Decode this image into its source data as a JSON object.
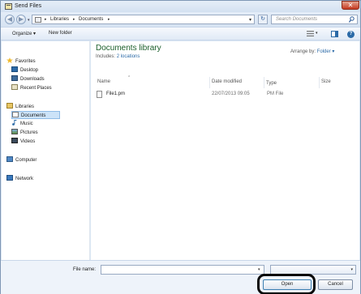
{
  "window": {
    "title": "Send Files",
    "close_glyph": "✕"
  },
  "nav": {
    "back_glyph": "◀",
    "forward_glyph": "▶",
    "breadcrumbs": [
      "Libraries",
      "Documents"
    ],
    "crumb_separator": "▸",
    "search_placeholder": "Search Documents"
  },
  "toolbar": {
    "organize_label": "Organize ▾",
    "new_folder_label": "New folder",
    "help_glyph": "?"
  },
  "sidebar": {
    "items": [
      {
        "label": "Favorites",
        "icon": "star-icon"
      },
      {
        "label": "Desktop",
        "icon": "desktop-icon"
      },
      {
        "label": "Downloads",
        "icon": "downloads-icon"
      },
      {
        "label": "Recent Places",
        "icon": "recent-places-icon"
      },
      {
        "label": "Libraries",
        "icon": "libraries-icon"
      },
      {
        "label": "Documents",
        "icon": "documents-icon",
        "selected": true
      },
      {
        "label": "Music",
        "icon": "music-icon"
      },
      {
        "label": "Pictures",
        "icon": "pictures-icon"
      },
      {
        "label": "Videos",
        "icon": "videos-icon"
      },
      {
        "label": "Computer",
        "icon": "computer-icon"
      },
      {
        "label": "Network",
        "icon": "network-icon"
      }
    ]
  },
  "library": {
    "title": "Documents library",
    "includes_label": "Includes:",
    "includes_link": "2 locations",
    "arrange_label": "Arrange by:",
    "arrange_value": "Folder ▾"
  },
  "columns": [
    "Name",
    "Date modified",
    "Type",
    "Size"
  ],
  "files": [
    {
      "name": "File1.pm",
      "date_modified": "22/07/2013 09:05",
      "type": "PM File",
      "size": ""
    }
  ],
  "footer": {
    "file_name_label": "File name:",
    "file_name_value": "",
    "open_label": "Open",
    "cancel_label": "Cancel"
  },
  "colors": {
    "library_title": "#1a5e2a",
    "link": "#2b6aa7",
    "selection": "#cce3f8",
    "highlight_ring": "#0a0a0a"
  }
}
